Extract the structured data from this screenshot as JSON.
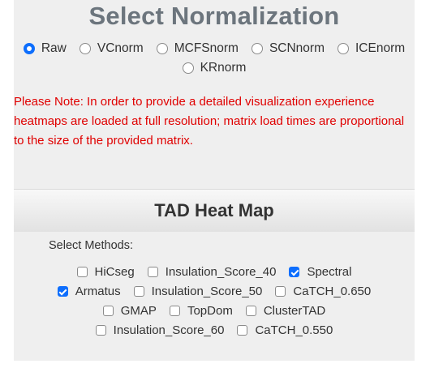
{
  "normalization": {
    "title": "Select Normalization",
    "options": [
      {
        "label": "Raw",
        "checked": true
      },
      {
        "label": "VCnorm",
        "checked": false
      },
      {
        "label": "MCFSnorm",
        "checked": false
      },
      {
        "label": "SCNnorm",
        "checked": false
      },
      {
        "label": "ICEnorm",
        "checked": false
      },
      {
        "label": "KRnorm",
        "checked": false
      }
    ],
    "note": "Please Note: In order to provide a detailed visualization experience heatmaps are loaded at full resolution; matrix load times are proportional to the size of the provided matrix.",
    "note_color": "#e00000",
    "selected_color": "#0d6efd"
  },
  "heatmap": {
    "title": "TAD Heat Map",
    "methods_label": "Select Methods:",
    "methods": [
      {
        "label": "HiCseg",
        "checked": false
      },
      {
        "label": "Insulation_Score_40",
        "checked": false
      },
      {
        "label": "Spectral",
        "checked": true
      },
      {
        "label": "Armatus",
        "checked": true
      },
      {
        "label": "Insulation_Score_50",
        "checked": false
      },
      {
        "label": "CaTCH_0.650",
        "checked": false
      },
      {
        "label": "GMAP",
        "checked": false
      },
      {
        "label": "TopDom",
        "checked": false
      },
      {
        "label": "ClusterTAD",
        "checked": false
      },
      {
        "label": "Insulation_Score_60",
        "checked": false
      },
      {
        "label": "CaTCH_0.550",
        "checked": false
      }
    ]
  }
}
